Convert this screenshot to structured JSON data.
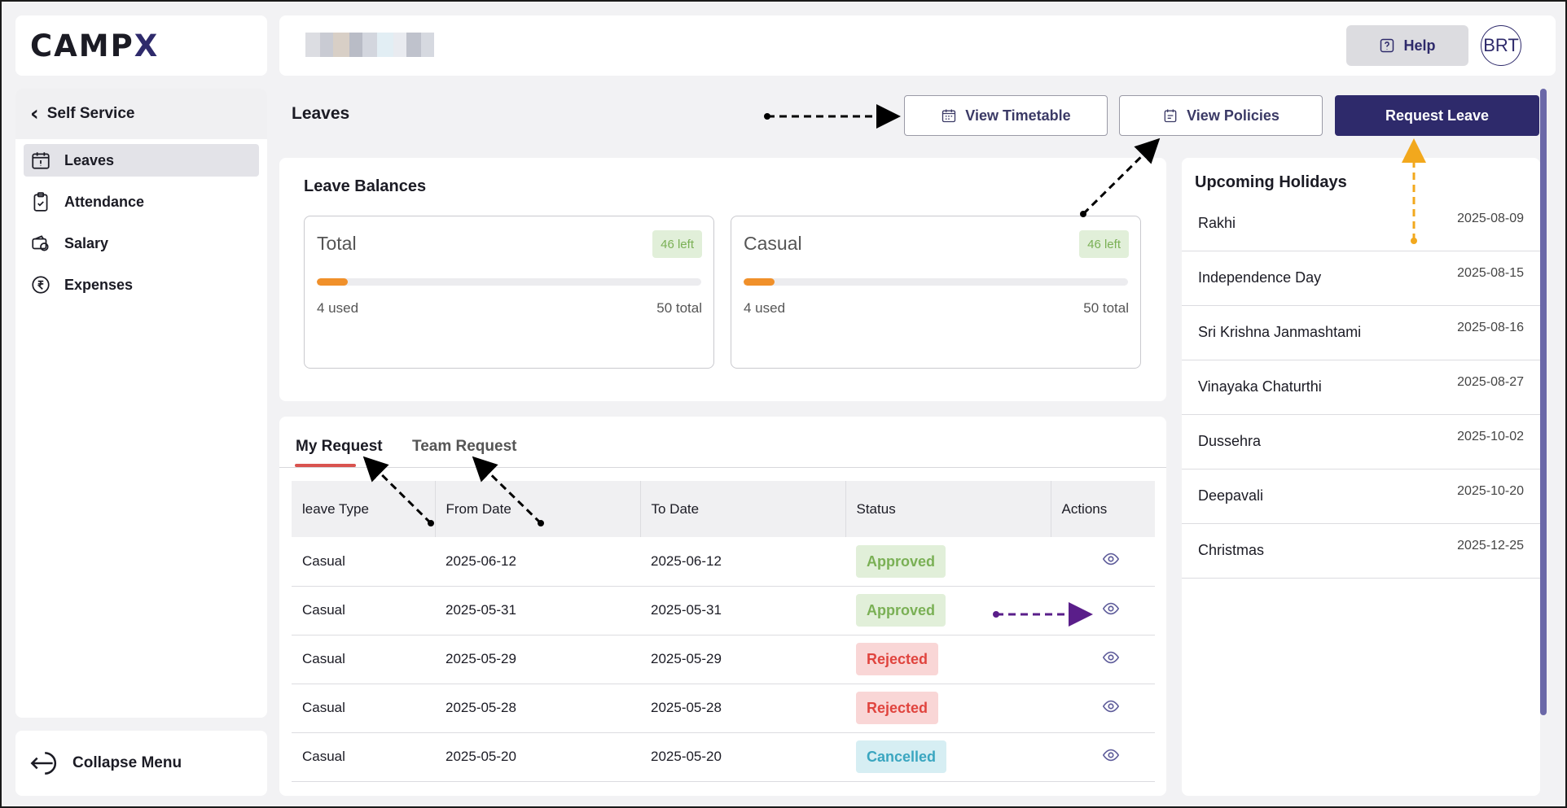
{
  "app": {
    "logo_main": "CAMP",
    "logo_accent": "X"
  },
  "sidebar": {
    "header": "Self Service",
    "items": [
      {
        "label": "Leaves",
        "icon": "calendar-alert-icon",
        "active": true
      },
      {
        "label": "Attendance",
        "icon": "clipboard-check-icon",
        "active": false
      },
      {
        "label": "Salary",
        "icon": "wallet-icon",
        "active": false
      },
      {
        "label": "Expenses",
        "icon": "rupee-circle-icon",
        "active": false
      }
    ],
    "collapse_label": "Collapse Menu"
  },
  "topbar": {
    "help_label": "Help",
    "avatar_initials": "BRT"
  },
  "page": {
    "title": "Leaves",
    "view_timetable": "View Timetable",
    "view_policies": "View Policies",
    "request_leave": "Request Leave"
  },
  "balances": {
    "title": "Leave Balances",
    "cards": [
      {
        "name": "Total",
        "left_label": "46 left",
        "used_label": "4 used",
        "total_label": "50 total",
        "used_fraction": 0.08
      },
      {
        "name": "Casual",
        "left_label": "46 left",
        "used_label": "4 used",
        "total_label": "50 total",
        "used_fraction": 0.08
      }
    ]
  },
  "requests": {
    "tabs": [
      "My Request",
      "Team Request"
    ],
    "active_tab": "My Request",
    "columns": [
      "leave Type",
      "From Date",
      "To Date",
      "Status",
      "Actions"
    ],
    "rows": [
      {
        "type": "Casual",
        "from": "2025-06-12",
        "to": "2025-06-12",
        "status": "Approved"
      },
      {
        "type": "Casual",
        "from": "2025-05-31",
        "to": "2025-05-31",
        "status": "Approved"
      },
      {
        "type": "Casual",
        "from": "2025-05-29",
        "to": "2025-05-29",
        "status": "Rejected"
      },
      {
        "type": "Casual",
        "from": "2025-05-28",
        "to": "2025-05-28",
        "status": "Rejected"
      },
      {
        "type": "Casual",
        "from": "2025-05-20",
        "to": "2025-05-20",
        "status": "Cancelled"
      }
    ]
  },
  "holidays": {
    "title": "Upcoming Holidays",
    "items": [
      {
        "name": "Rakhi",
        "date": "2025-08-09"
      },
      {
        "name": "Independence Day",
        "date": "2025-08-15"
      },
      {
        "name": "Sri Krishna Janmashtami",
        "date": "2025-08-16"
      },
      {
        "name": "Vinayaka Chaturthi",
        "date": "2025-08-27"
      },
      {
        "name": "Dussehra",
        "date": "2025-10-02"
      },
      {
        "name": "Deepavali",
        "date": "2025-10-20"
      },
      {
        "name": "Christmas",
        "date": "2025-12-25"
      }
    ]
  },
  "colors": {
    "brand": "#2e2a6b",
    "approved": "#7ab055",
    "rejected": "#e0443e",
    "cancelled": "#3aa6c0",
    "progress": "#f0902a",
    "tab_underline": "#d9534f"
  }
}
